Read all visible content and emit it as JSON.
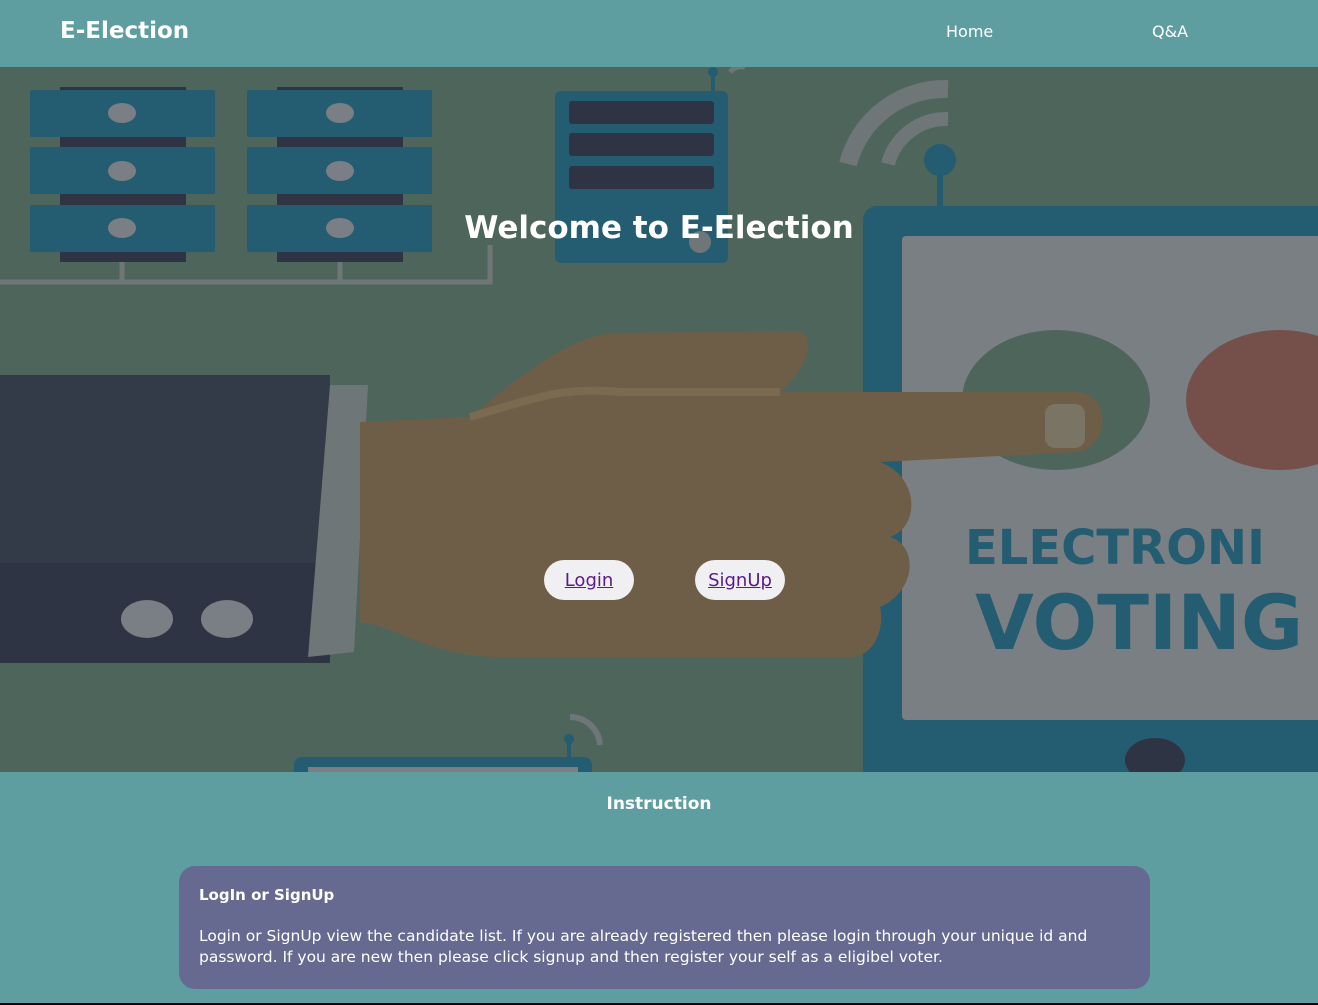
{
  "navbar": {
    "brand": "E-Election",
    "links": [
      {
        "label": "Home"
      },
      {
        "label": "Q&A"
      }
    ]
  },
  "hero": {
    "title": "Welcome to E-Election",
    "login_label": "Login",
    "signup_label": "SignUp",
    "illustration_text_1": "ELECTRONI",
    "illustration_text_2": "VOTING"
  },
  "instruction": {
    "heading": "Instruction",
    "card": {
      "title": "LogIn or SignUp",
      "body": "Login or SignUp view the candidate list. If you are already registered then please login through your unique id and password. If you are new then please click signup and then register your self as a eligibel voter."
    }
  },
  "colors": {
    "navbar_bg": "#5f9ea0",
    "hero_overlay": "#4e655b",
    "card_bg": "#666a90",
    "button_bg": "#f0eff2",
    "link_text": "#5a1a8c"
  }
}
